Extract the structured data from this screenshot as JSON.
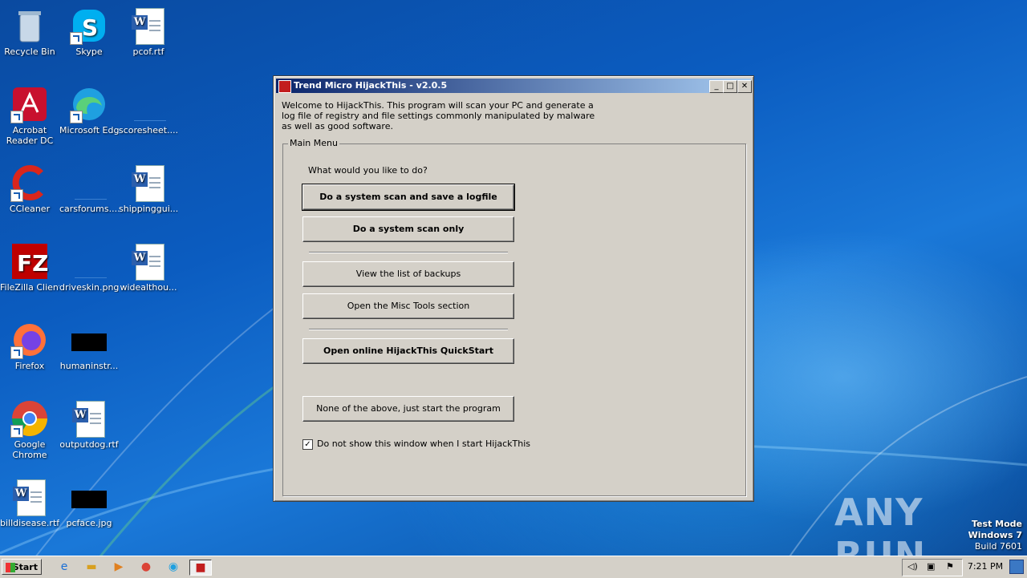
{
  "desktop": {
    "icons": [
      {
        "label": "Recycle Bin"
      },
      {
        "label": "Skype"
      },
      {
        "label": "pcof.rtf"
      },
      {
        "label": "Acrobat Reader DC"
      },
      {
        "label": "Microsoft Edge"
      },
      {
        "label": "scoresheet...."
      },
      {
        "label": "CCleaner"
      },
      {
        "label": "carsforums...."
      },
      {
        "label": "shippinggui..."
      },
      {
        "label": "FileZilla Client"
      },
      {
        "label": "driveskin.png"
      },
      {
        "label": "widealthou..."
      },
      {
        "label": "Firefox"
      },
      {
        "label": "humaninstr..."
      },
      {
        "label": "Google Chrome"
      },
      {
        "label": "outputdog.rtf"
      },
      {
        "label": "billdisease.rtf"
      },
      {
        "label": "pcface.jpg"
      }
    ]
  },
  "window": {
    "title": "Trend Micro HijackThis - v2.0.5",
    "intro": "Welcome to HijackThis. This program will scan your PC and generate a log file of registry and file settings commonly manipulated by malware as well as good software.",
    "group_label": "Main Menu",
    "question": "What would you like to do?",
    "buttons": {
      "scan_save": "Do a system scan and save a logfile",
      "scan_only": "Do a system scan only",
      "backups": "View the list of backups",
      "misc_tools": "Open the Misc Tools section",
      "quickstart": "Open online HijackThis QuickStart",
      "none": "None of the above, just start the program"
    },
    "checkbox_label": "Do not show this window when I start HijackThis",
    "checkbox_checked": true,
    "controls": {
      "minimize": "_",
      "maximize": "□",
      "close": "✕"
    }
  },
  "taskbar": {
    "start_label": "Start",
    "clock": "7:21 PM"
  },
  "watermark": "ANY RUN",
  "test_mode": {
    "line1": "Test Mode",
    "line2": "Windows 7",
    "line3": "Build 7601"
  }
}
